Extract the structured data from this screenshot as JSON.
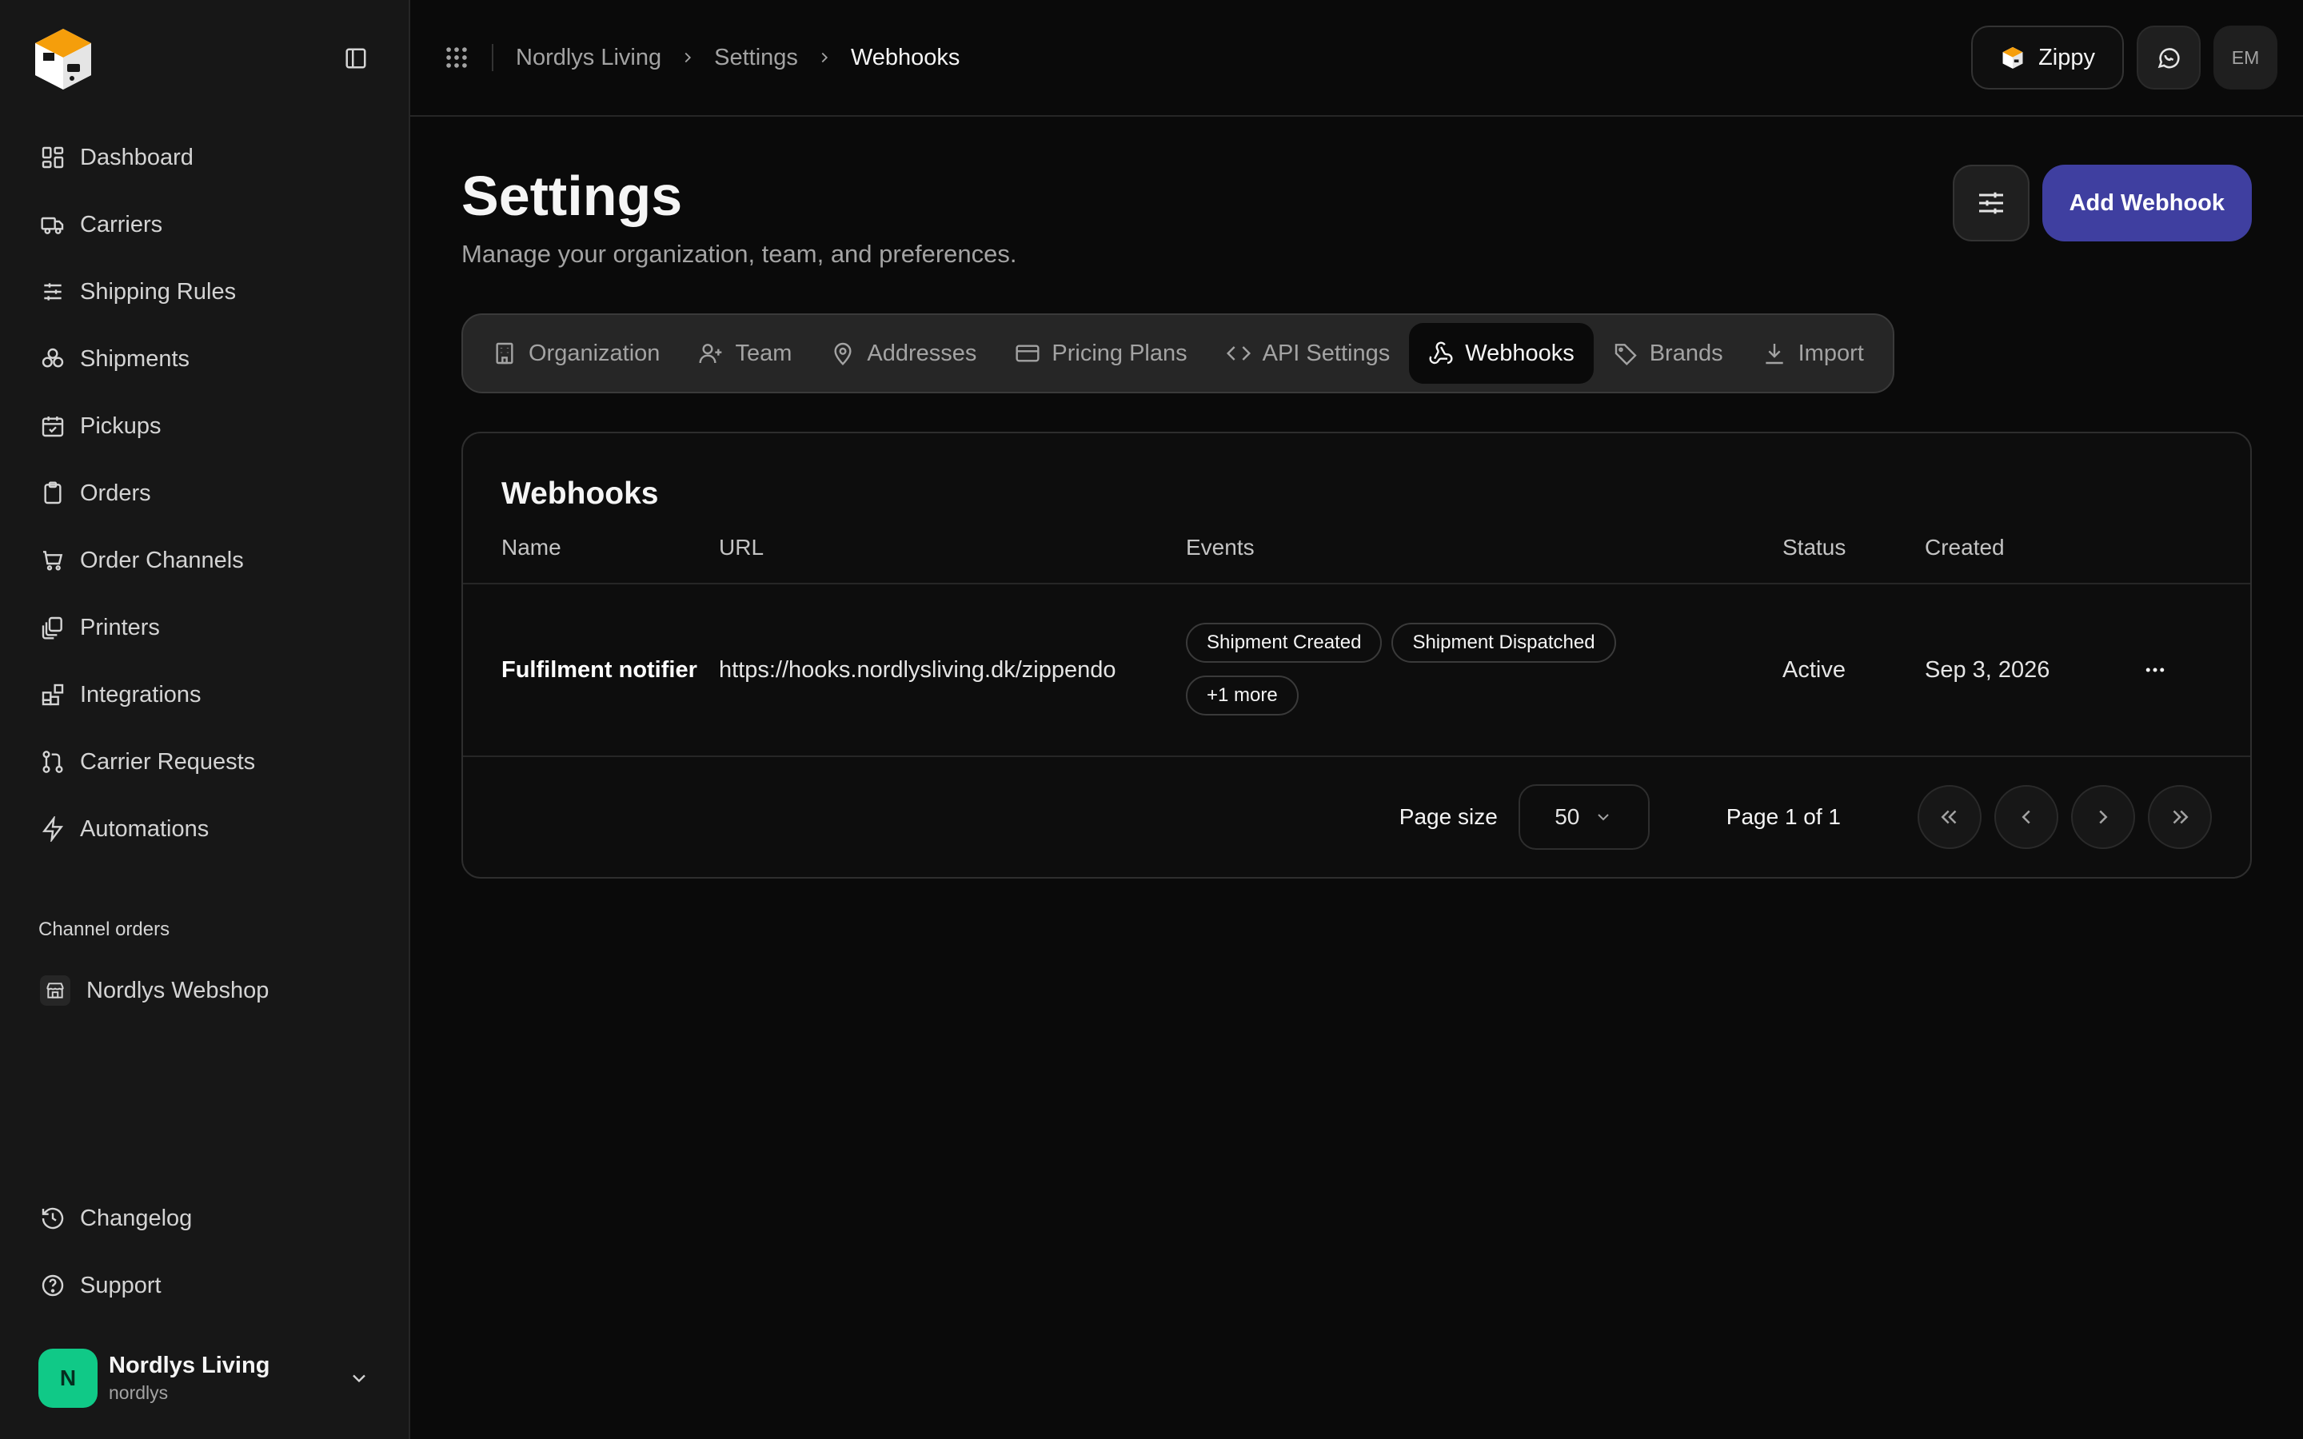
{
  "sidebar": {
    "nav": [
      {
        "label": "Dashboard",
        "icon": "dashboard-icon"
      },
      {
        "label": "Carriers",
        "icon": "truck-icon"
      },
      {
        "label": "Shipping Rules",
        "icon": "sliders-icon"
      },
      {
        "label": "Shipments",
        "icon": "boxes-icon"
      },
      {
        "label": "Pickups",
        "icon": "calendar-check-icon"
      },
      {
        "label": "Orders",
        "icon": "clipboard-icon"
      },
      {
        "label": "Order Channels",
        "icon": "cart-icon"
      },
      {
        "label": "Printers",
        "icon": "printer-stack-icon"
      },
      {
        "label": "Integrations",
        "icon": "blocks-icon"
      },
      {
        "label": "Carrier Requests",
        "icon": "git-pull-icon"
      },
      {
        "label": "Automations",
        "icon": "zap-icon"
      }
    ],
    "channel_section_label": "Channel orders",
    "channel_item": "Nordlys Webshop",
    "bottom": [
      {
        "label": "Changelog",
        "icon": "history-icon"
      },
      {
        "label": "Support",
        "icon": "help-circle-icon"
      }
    ],
    "org": {
      "initial": "N",
      "name": "Nordlys Living",
      "slug": "nordlys"
    }
  },
  "topbar": {
    "breadcrumbs": [
      "Nordlys Living",
      "Settings",
      "Webhooks"
    ],
    "assistant_label": "Zippy",
    "avatar_initials": "EM"
  },
  "page": {
    "title": "Settings",
    "subtitle": "Manage your organization, team, and preferences.",
    "add_button": "Add Webhook"
  },
  "tabs": [
    {
      "label": "Organization",
      "active": false
    },
    {
      "label": "Team",
      "active": false
    },
    {
      "label": "Addresses",
      "active": false
    },
    {
      "label": "Pricing Plans",
      "active": false
    },
    {
      "label": "API Settings",
      "active": false
    },
    {
      "label": "Webhooks",
      "active": true
    },
    {
      "label": "Brands",
      "active": false
    },
    {
      "label": "Import",
      "active": false
    }
  ],
  "webhooks": {
    "title": "Webhooks",
    "columns": [
      "Name",
      "URL",
      "Events",
      "Status",
      "Created"
    ],
    "rows": [
      {
        "name": "Fulfilment notifier",
        "url": "https://hooks.nordlysliving.dk/zippendo",
        "events": [
          "Shipment Created",
          "Shipment Dispatched"
        ],
        "more": "+1 more",
        "status": "Active",
        "created": "Sep 3, 2026"
      }
    ]
  },
  "pagination": {
    "page_size_label": "Page size",
    "page_size": "50",
    "page_info": "Page 1 of 1"
  },
  "colors": {
    "accent": "#3f3fa0",
    "org_avatar": "#10c987",
    "logo_orange": "#f59e0b"
  }
}
